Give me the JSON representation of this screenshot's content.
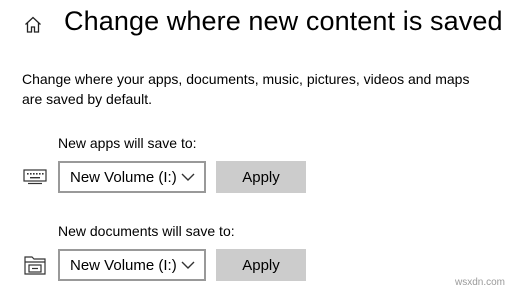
{
  "header": {
    "title": "Change where new content is saved",
    "home_icon": "home-icon"
  },
  "description": "Change where your apps, documents, music, pictures, videos and maps are saved by default.",
  "rows": [
    {
      "label": "New apps will save to:",
      "icon": "keyboard-icon",
      "selected": "New Volume (I:)",
      "apply_label": "Apply"
    },
    {
      "label": "New documents will save to:",
      "icon": "folder-drive-icon",
      "selected": "New Volume (I:)",
      "apply_label": "Apply"
    }
  ],
  "watermark": "wsxdn.com"
}
